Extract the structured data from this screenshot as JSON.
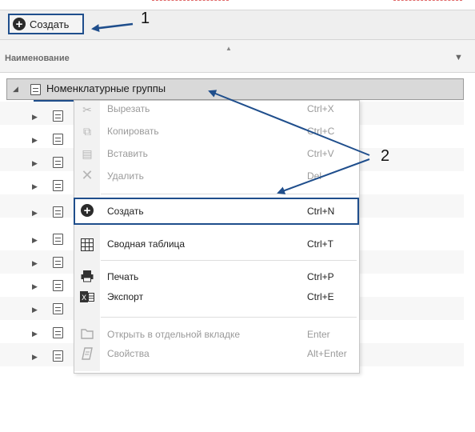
{
  "toolbar": {
    "create_label": "Создать"
  },
  "annotations": {
    "one": "1",
    "two": "2"
  },
  "grid": {
    "column_title": "Наименование",
    "root_label": "Номенклатурные группы"
  },
  "context_menu": {
    "items": [
      {
        "label": "Вырезать",
        "shortcut": "Ctrl+X",
        "icon": "scissors-icon",
        "enabled": false
      },
      {
        "label": "Копировать",
        "shortcut": "Ctrl+C",
        "icon": "copy-icon",
        "enabled": false
      },
      {
        "label": "Вставить",
        "shortcut": "Ctrl+V",
        "icon": "paste-icon",
        "enabled": false
      },
      {
        "label": "Удалить",
        "shortcut": "Del",
        "icon": "delete-icon",
        "enabled": false
      },
      {
        "label": "Создать",
        "shortcut": "Ctrl+N",
        "icon": "plus-circle-icon",
        "enabled": true
      },
      {
        "label": "Сводная таблица",
        "shortcut": "Ctrl+T",
        "icon": "pivot-table-icon",
        "enabled": true
      },
      {
        "label": "Печать",
        "shortcut": "Ctrl+P",
        "icon": "printer-icon",
        "enabled": true
      },
      {
        "label": "Экспорт",
        "shortcut": "Ctrl+E",
        "icon": "excel-export-icon",
        "enabled": true
      },
      {
        "label": "Открыть в отдельной вкладке",
        "shortcut": "Enter",
        "icon": "folder-icon",
        "enabled": false
      },
      {
        "label": "Свойства",
        "shortcut": "Alt+Enter",
        "icon": "properties-icon",
        "enabled": false
      }
    ]
  },
  "colors": {
    "annotation_blue": "#1f4e8c",
    "root_row_bg": "#d9d9d9",
    "disabled_text": "#9a9a9a"
  }
}
